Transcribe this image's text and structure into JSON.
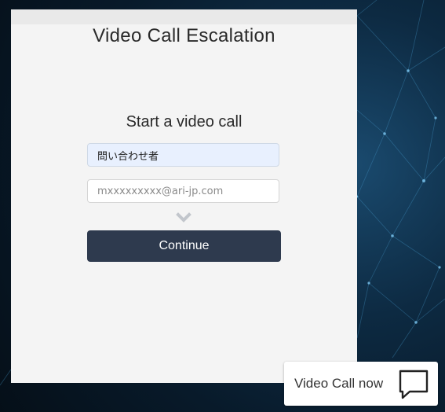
{
  "form": {
    "title": "Video Call Escalation",
    "subtitle": "Start a video call",
    "name_value": "問い合わせ者",
    "email_placeholder": "mxxxxxxxxx@ari-jp.com",
    "continue_label": "Continue"
  },
  "widget": {
    "label": "Video Call now",
    "icon": "chat-bubble-icon"
  },
  "colors": {
    "button_bg": "#2e3a4e",
    "name_field_bg": "#e8f0fe",
    "panel_bg": "#f4f4f4"
  }
}
